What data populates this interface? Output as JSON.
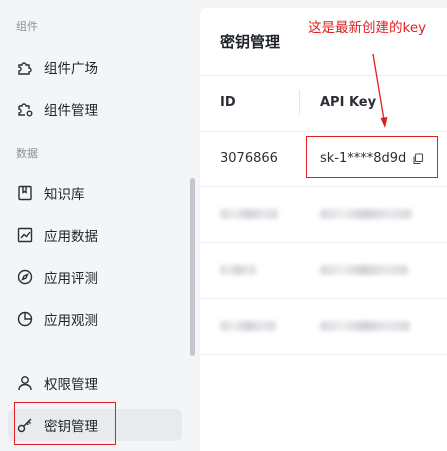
{
  "sidebar": {
    "sections": [
      {
        "label": "组件"
      },
      {
        "label": "数据"
      }
    ],
    "items": [
      {
        "label": "组件广场",
        "icon": "puzzle-icon"
      },
      {
        "label": "组件管理",
        "icon": "puzzle-gear-icon"
      },
      {
        "label": "知识库",
        "icon": "book-icon"
      },
      {
        "label": "应用数据",
        "icon": "chart-line-icon"
      },
      {
        "label": "应用评测",
        "icon": "compass-icon"
      },
      {
        "label": "应用观测",
        "icon": "pie-chart-icon"
      },
      {
        "label": "权限管理",
        "icon": "user-icon"
      },
      {
        "label": "密钥管理",
        "icon": "key-icon"
      }
    ],
    "active": "密钥管理"
  },
  "main": {
    "title": "密钥管理",
    "columns": [
      "ID",
      "API Key"
    ],
    "rows": [
      {
        "id": "3076866",
        "api_key": "sk-1****8d9d",
        "redacted": false
      },
      {
        "id": "",
        "api_key": "",
        "redacted": true
      },
      {
        "id": "",
        "api_key": "",
        "redacted": true
      },
      {
        "id": "",
        "api_key": "",
        "redacted": true
      }
    ]
  },
  "annotation": {
    "text": "这是最新创建的key",
    "color": "#e02020"
  }
}
